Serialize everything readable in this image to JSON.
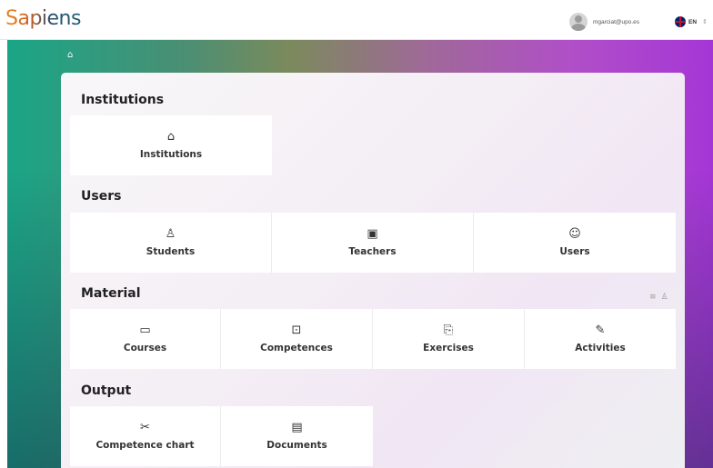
{
  "header": {
    "logo": "Sapiens",
    "user_email": "mgarciat@upo.es",
    "language": "EN"
  },
  "breadcrumb": {
    "home_icon": "home-icon"
  },
  "sections": {
    "institutions": {
      "title": "Institutions",
      "cards": [
        {
          "label": "Institutions",
          "icon": "building-icon"
        }
      ]
    },
    "users": {
      "title": "Users",
      "cards": [
        {
          "label": "Students",
          "icon": "graduation-icon"
        },
        {
          "label": "Teachers",
          "icon": "board-icon"
        },
        {
          "label": "Users",
          "icon": "user-circle-icon"
        }
      ]
    },
    "material": {
      "title": "Material",
      "cards": [
        {
          "label": "Courses",
          "icon": "archive-icon"
        },
        {
          "label": "Competences",
          "icon": "bookmark-plus-icon"
        },
        {
          "label": "Exercises",
          "icon": "file-search-icon"
        },
        {
          "label": "Activities",
          "icon": "pencil-icon"
        }
      ]
    },
    "output": {
      "title": "Output",
      "cards": [
        {
          "label": "Competence chart",
          "icon": "chart-icon"
        },
        {
          "label": "Documents",
          "icon": "document-icon"
        }
      ]
    }
  }
}
